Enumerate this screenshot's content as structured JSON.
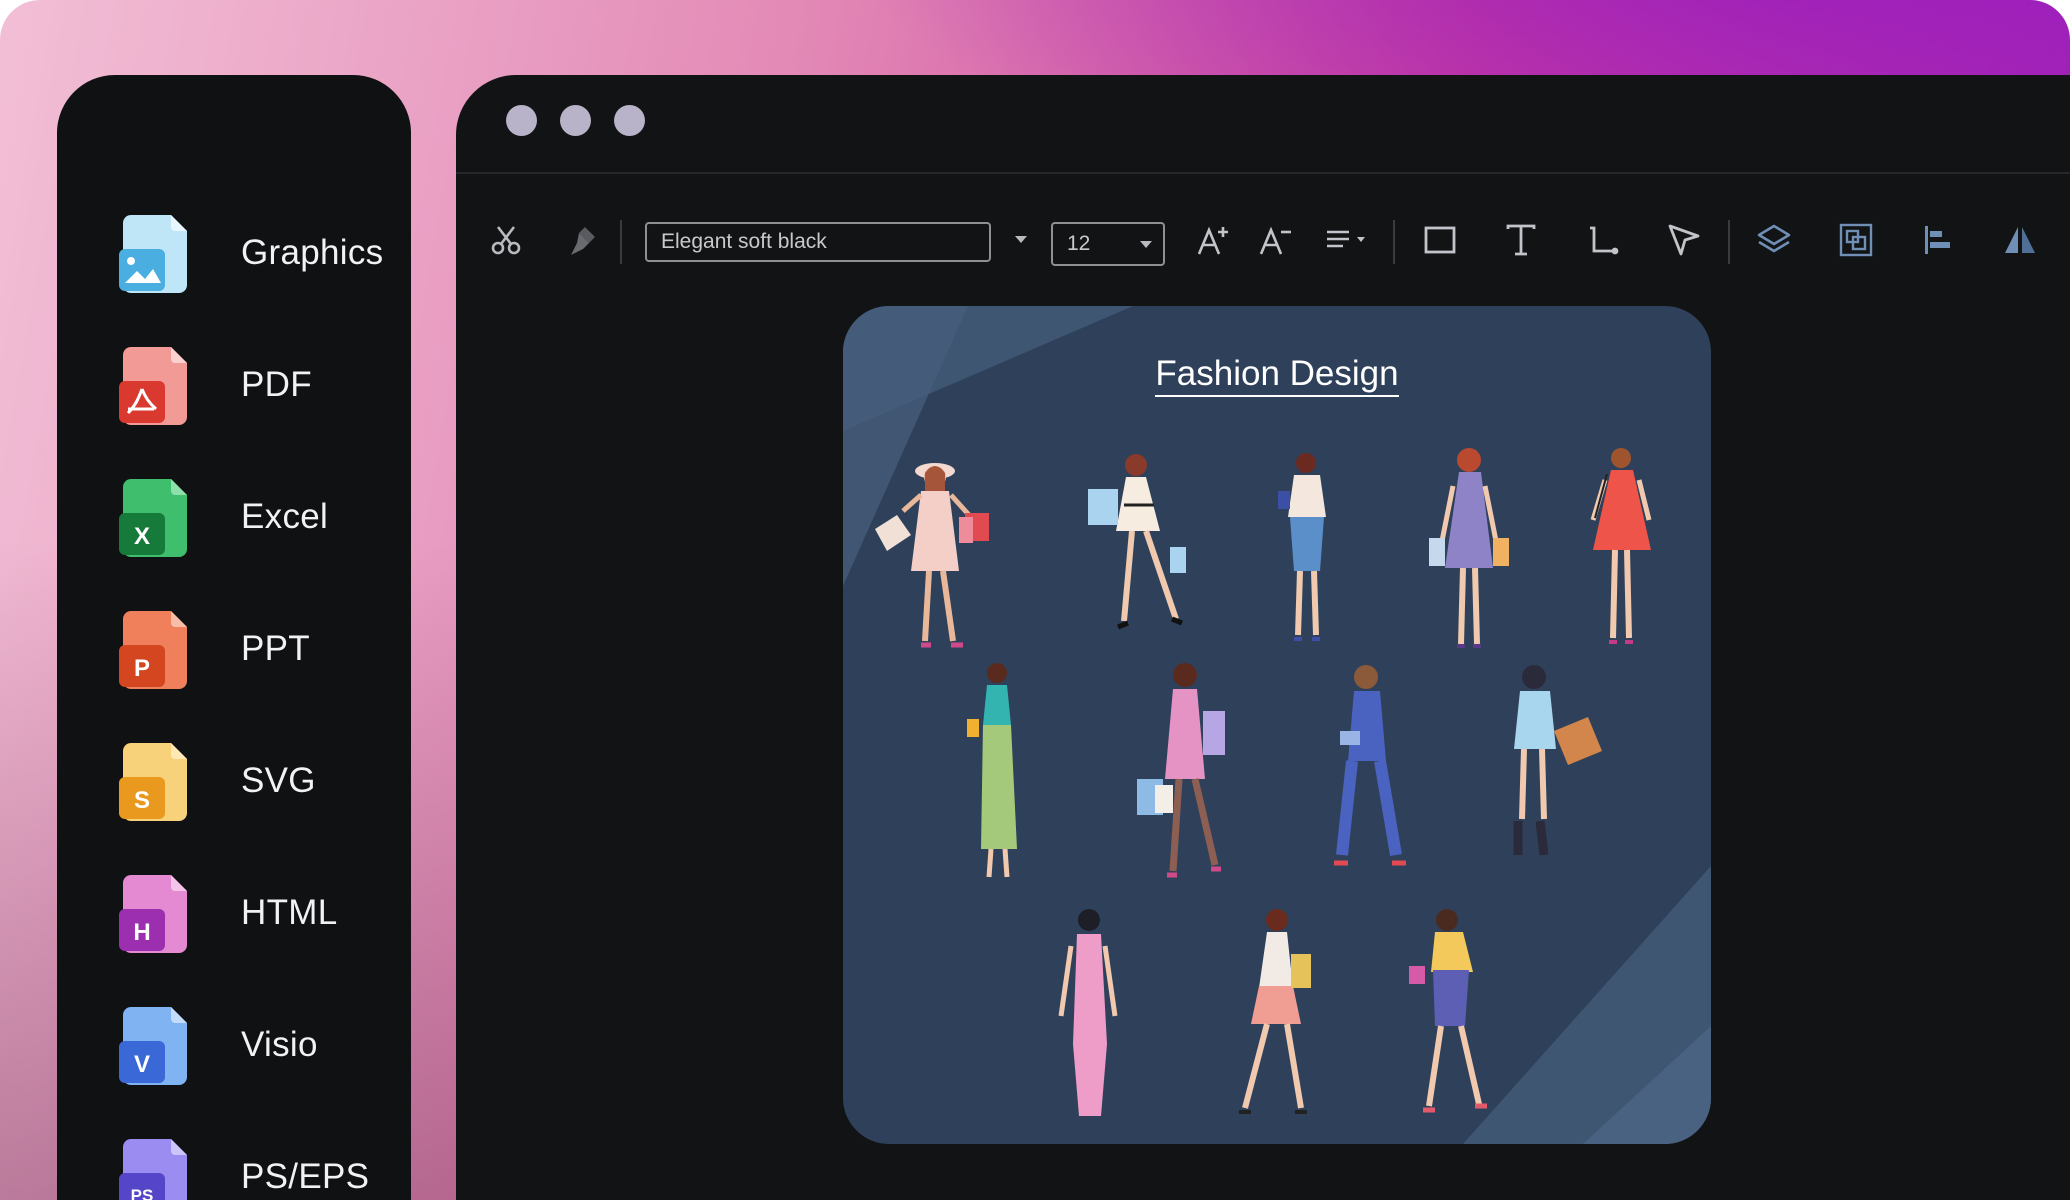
{
  "sidebar": {
    "items": [
      {
        "label": "Graphics",
        "icon": "image-file-icon",
        "color": "#4fb3e6"
      },
      {
        "label": "PDF",
        "icon": "pdf-file-icon",
        "color": "#e2453a"
      },
      {
        "label": "Excel",
        "icon": "excel-file-icon",
        "color": "#1e8a46",
        "letter": "X"
      },
      {
        "label": "PPT",
        "icon": "ppt-file-icon",
        "color": "#e0512e",
        "letter": "P"
      },
      {
        "label": "SVG",
        "icon": "svg-file-icon",
        "color": "#eba12a",
        "letter": "S"
      },
      {
        "label": "HTML",
        "icon": "html-file-icon",
        "color": "#a43ab5",
        "letter": "H"
      },
      {
        "label": "Visio",
        "icon": "visio-file-icon",
        "color": "#3d6fd8",
        "letter": "V"
      },
      {
        "label": "PS/EPS",
        "icon": "ps-eps-file-icon",
        "color": "#5a4fd0",
        "letter": "PS"
      }
    ]
  },
  "toolbar": {
    "font_name": "Elegant soft black",
    "font_size": "12",
    "tools": [
      "scissors-icon",
      "format-painter-icon",
      "font-increase-icon",
      "font-decrease-icon",
      "align-icon",
      "rectangle-icon",
      "text-icon",
      "connector-icon",
      "pointer-icon",
      "layers-icon",
      "group-icon",
      "align-left-icon",
      "flip-icon"
    ]
  },
  "canvas": {
    "title": "Fashion Design",
    "background": "#2f415a"
  },
  "colors": {
    "frame_start": "#f2bfd6",
    "frame_end": "#9b1dba",
    "panel": "#101113",
    "editor": "#121315"
  }
}
